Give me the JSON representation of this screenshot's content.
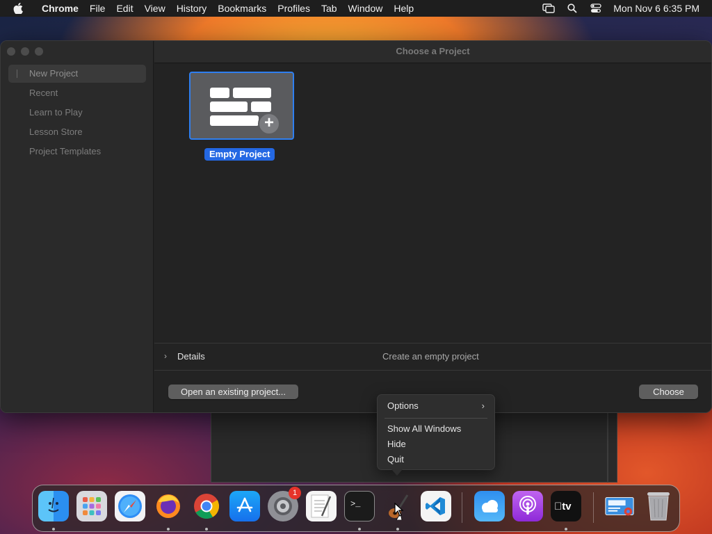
{
  "menubar": {
    "app": "Chrome",
    "items": [
      "File",
      "Edit",
      "View",
      "History",
      "Bookmarks",
      "Profiles",
      "Tab",
      "Window",
      "Help"
    ],
    "clock": "Mon Nov 6  6:35 PM"
  },
  "window": {
    "title": "Choose a Project",
    "sidebar": [
      "New Project",
      "Recent",
      "Learn to Play",
      "Lesson Store",
      "Project Templates"
    ],
    "tile_label": "Empty Project",
    "details_label": "Details",
    "details_desc": "Create an empty project",
    "open_button": "Open an existing project...",
    "choose_button": "Choose"
  },
  "context_menu": {
    "items": [
      "Options",
      "Show All Windows",
      "Hide",
      "Quit"
    ]
  },
  "dock": {
    "icons": [
      "finder-icon",
      "launchpad-icon",
      "safari-icon",
      "firefox-icon",
      "chrome-icon",
      "app-store-icon",
      "system-settings-icon",
      "textedit-icon",
      "terminal-icon",
      "garageband-icon",
      "vscode-icon",
      "weather-icon",
      "podcasts-icon",
      "apple-tv-icon",
      "preview-icon",
      "trash-icon"
    ],
    "settings_badge": "1"
  }
}
